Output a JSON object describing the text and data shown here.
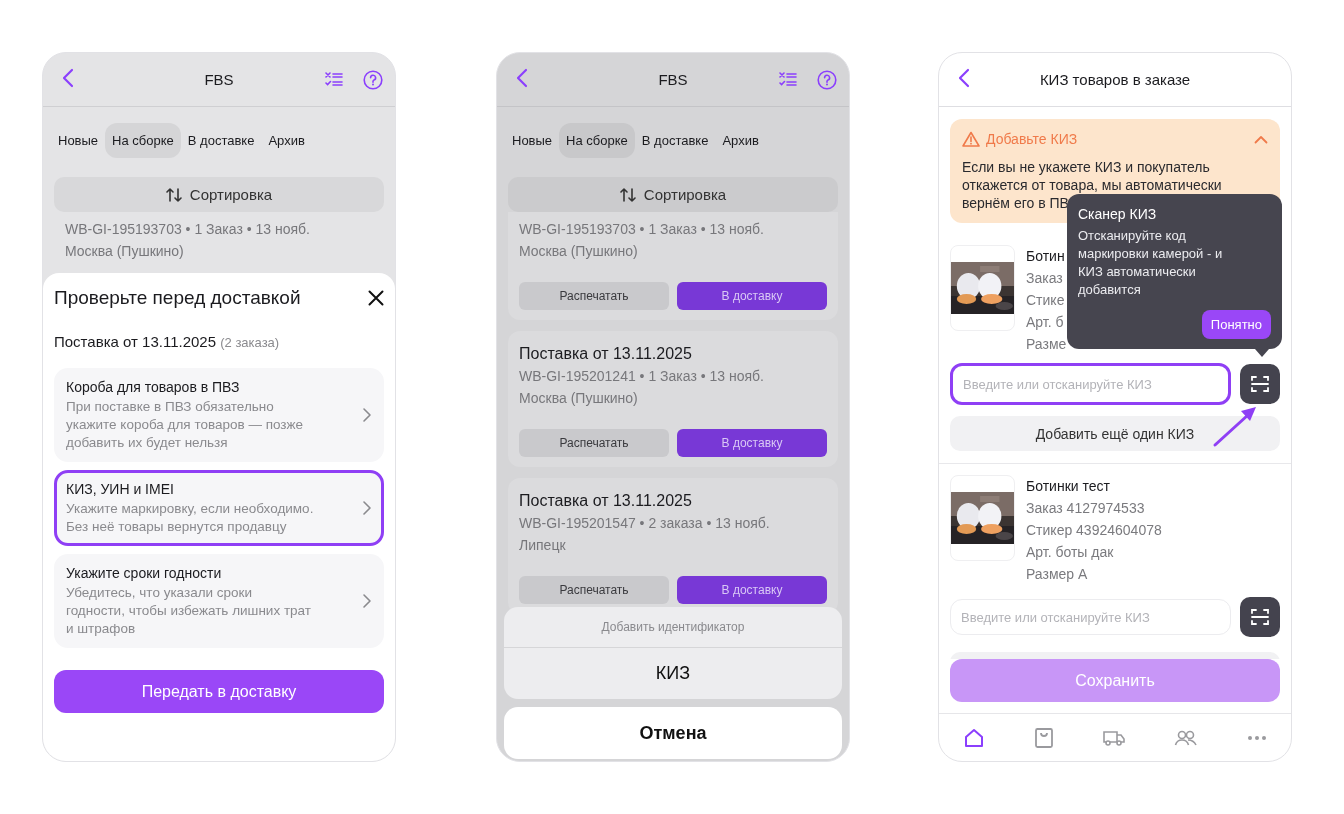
{
  "screens": [
    {
      "kind": "delivery_check",
      "title": "FBS",
      "tabs": [
        {
          "label": "Новые",
          "selected": false
        },
        {
          "label": "На сборке",
          "selected": true
        },
        {
          "label": "В доставке",
          "selected": false
        },
        {
          "label": "Архив",
          "selected": false
        }
      ],
      "sort_label": "Сортировка",
      "orders": [
        {
          "meta": "WB-GI-195193703 • 1 Заказ • 13 нояб.",
          "city": "Москва (Пушкино)"
        }
      ],
      "sheet": {
        "title": "Проверьте перед доставкой",
        "supply": "Поставка от 13.11.2025",
        "supply_count": "(2 заказа)",
        "options": [
          {
            "title": "Короба для товаров в ПВЗ",
            "description": "При поставке в ПВЗ обязательно укажите короба для товаров — позже добавить их будет нельзя",
            "highlighted": false
          },
          {
            "title": "КИЗ, УИН и IMEI",
            "description": "Укажите маркировку, если необходимо. Без неё товары вернутся продавцу",
            "highlighted": true
          },
          {
            "title": "Укажите сроки годности",
            "description": "Убедитесь, что указали сроки годности, чтобы избежать лишних трат и штрафов",
            "highlighted": false
          }
        ],
        "button": "Передать в доставку"
      }
    },
    {
      "kind": "identifier_menu",
      "title": "FBS",
      "tabs": [
        {
          "label": "Новые",
          "selected": false
        },
        {
          "label": "На сборке",
          "selected": true
        },
        {
          "label": "В доставке",
          "selected": false
        },
        {
          "label": "Архив",
          "selected": false
        }
      ],
      "sort_label": "Сортировка",
      "orders": [
        {
          "meta": "WB-GI-195193703 • 1 Заказ • 13 нояб.",
          "city": "Москва (Пушкино)",
          "print_button": "Распечатать",
          "deliver_button": "В доставку"
        },
        {
          "title": "Поставка от 13.11.2025",
          "meta": "WB-GI-195201241 • 1 Заказ • 13 нояб.",
          "city": "Москва (Пушкино)",
          "print_button": "Распечатать",
          "deliver_button": "В доставку"
        },
        {
          "title": "Поставка от 13.11.2025",
          "meta": "WB-GI-195201547 • 2 заказа • 13 нояб.",
          "city": "Липецк",
          "print_button": "Распечатать",
          "deliver_button": "В доставку"
        }
      ],
      "action_sheet": {
        "caption": "Добавить идентификатор",
        "actions": [
          "КИЗ"
        ],
        "cancel": "Отмена"
      }
    },
    {
      "kind": "kiz_form",
      "title": "КИЗ товаров в заказе",
      "warning": {
        "title": "Добавьте КИЗ",
        "text": "Если вы не укажете КИЗ и покупатель откажется от товара, мы автоматически вернём его в ПВ",
        "expanded": true
      },
      "products": [
        {
          "name": "Ботин",
          "order": "Заказ",
          "sticker": "Стике",
          "article": "Арт. б",
          "size": "Разме",
          "kiz_placeholder": "Введите или отсканируйте КИЗ",
          "highlighted": true,
          "add_button": "Добавить ещё один КИЗ"
        },
        {
          "name": "Ботинки тест",
          "order": "Заказ 4127974533",
          "sticker": "Стикер 43924604078",
          "article": "Арт. боты дак",
          "size": "Размер А",
          "kiz_placeholder": "Введите или отсканируйте КИЗ",
          "highlighted": false
        }
      ],
      "tooltip": {
        "title": "Сканер КИЗ",
        "text": "Отсканируйте код маркировки камерой - и КИЗ автоматически добавится",
        "button": "Понятно"
      },
      "save_button": {
        "label": "Сохранить",
        "disabled": true
      },
      "nav": [
        {
          "kind": "home",
          "selected": true
        },
        {
          "kind": "bag",
          "selected": false
        },
        {
          "kind": "truck",
          "selected": false
        },
        {
          "kind": "people",
          "selected": false
        },
        {
          "kind": "more",
          "selected": false
        }
      ]
    }
  ]
}
